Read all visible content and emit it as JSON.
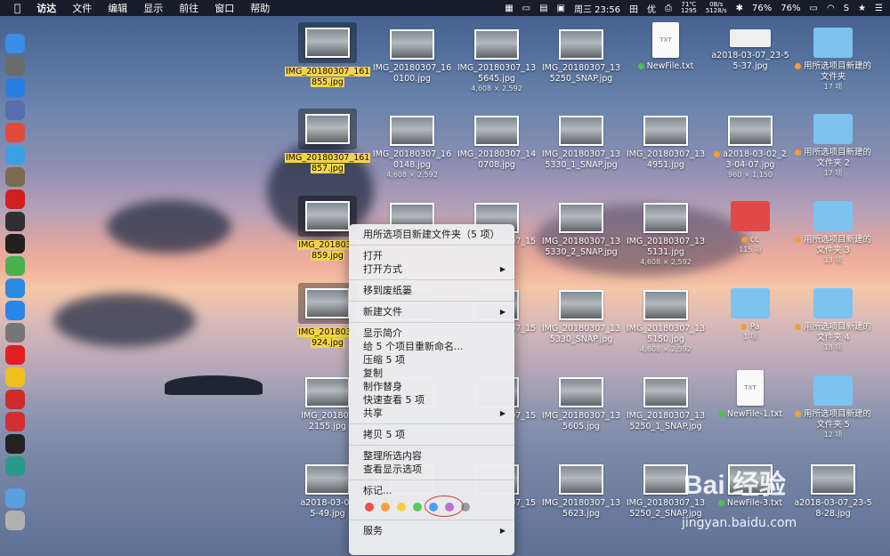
{
  "menubar": {
    "apple_icon": "apple-logo-icon",
    "items": [
      "访达",
      "文件",
      "编辑",
      "显示",
      "前往",
      "窗口",
      "帮助"
    ],
    "temp": "71℃",
    "rpm": "1295",
    "net_up": "0B/s",
    "net_down": "5128/s",
    "battery1": "76%",
    "battery2": "76%",
    "clock": "周三 23:56",
    "user": "田",
    "ime": "优"
  },
  "dock_icons": [
    "finder-icon",
    "launchpad-icon",
    "safari-icon",
    "preview-icon",
    "app-icon",
    "photos-icon",
    "app-icon",
    "stocks-icon",
    "activity-monitor-icon",
    "terminal-icon",
    "maps-icon",
    "siri-icon",
    "app-store-icon",
    "system-preferences-icon",
    "yandex-icon",
    "chrome-icon",
    "netease-music-icon",
    "vivaldi-icon",
    "terminal-icon",
    "app-icon",
    "folder-icon",
    "trash-icon"
  ],
  "files": [
    {
      "name": "IMG_20180307_161855.jpg",
      "l1": "IMG_20180307_161",
      "l2": "855.jpg",
      "type": "photo",
      "hl": true
    },
    {
      "name": "IMG_20180307_160100.jpg",
      "l1": "IMG_20180307_16",
      "l2": "0100.jpg",
      "type": "photo"
    },
    {
      "name": "IMG_20180307_135645.jpg",
      "l1": "IMG_20180307_13",
      "l2": "5645.jpg",
      "type": "photo",
      "sub": "4,608 × 2,592"
    },
    {
      "name": "IMG_20180307_135250_SNAP.jpg",
      "l1": "IMG_20180307_13",
      "l2": "5250_SNAP.jpg",
      "type": "photo"
    },
    {
      "name": "NewFile.txt",
      "l1": "NewFile.txt",
      "l2": "",
      "type": "txt",
      "tag": "#4cc24c"
    },
    {
      "name": "a2018-03-07_23-55-37.jpg",
      "l1": "a2018-03-07_23-5",
      "l2": "5-37.jpg",
      "type": "kbd"
    },
    {
      "name": "用所选项目新建的文件夹",
      "l1": "用所选项目新建的",
      "l2": "文件夹",
      "type": "folder",
      "tag": "#f0a030",
      "sub": "17 项"
    },
    {
      "name": "IMG_20180307_161857.jpg",
      "l1": "IMG_20180307_161",
      "l2": "857.jpg",
      "type": "photo",
      "hl": true
    },
    {
      "name": "IMG_20180307_160148.jpg",
      "l1": "IMG_20180307_16",
      "l2": "0148.jpg",
      "type": "photo",
      "sub": "4,608 × 2,592"
    },
    {
      "name": "IMG_20180307_140708.jpg",
      "l1": "IMG_20180307_14",
      "l2": "0708.jpg",
      "type": "photo"
    },
    {
      "name": "IMG_20180307_135330_1_SNAP.jpg",
      "l1": "IMG_20180307_13",
      "l2": "5330_1_SNAP.jpg",
      "type": "photo"
    },
    {
      "name": "IMG_20180307_134951.jpg",
      "l1": "IMG_20180307_13",
      "l2": "4951.jpg",
      "type": "photo"
    },
    {
      "name": "a2018-03-02_23-04-07.jpg",
      "l1": "a2018-03-02_2",
      "l2": "3-04-07.jpg",
      "type": "photo",
      "tag": "#f0a030",
      "sub": "960 × 1,150"
    },
    {
      "name": "用所选项目新建的文件夹 2",
      "l1": "用所选项目新建的",
      "l2": "文件夹 2",
      "type": "folder",
      "tag": "#f0a030",
      "sub": "17 项"
    },
    {
      "name": "IMG_20180307_161859.jpg",
      "l1": "IMG_2018030",
      "l2": "859.jpg",
      "type": "photo",
      "hl": true
    },
    {
      "name": "",
      "l1": "",
      "l2": "",
      "type": "photo"
    },
    {
      "name": "IMG_20180307_15",
      "l1": "IMG_20180307_15",
      "l2": "",
      "type": "photo"
    },
    {
      "name": "IMG_20180307_135330_2_SNAP.jpg",
      "l1": "IMG_20180307_13",
      "l2": "5330_2_SNAP.jpg",
      "type": "photo"
    },
    {
      "name": "IMG_20180307_135131.jpg",
      "l1": "IMG_20180307_13",
      "l2": "5131.jpg",
      "type": "photo",
      "sub": "4,608 × 2,592"
    },
    {
      "name": "cc",
      "l1": "cc",
      "l2": "",
      "type": "redfolder",
      "tag": "#f0a030",
      "sub": "115 项"
    },
    {
      "name": "用所选项目新建的文件夹 3",
      "l1": "用所选项目新建的",
      "l2": "文件夹 3",
      "type": "folder",
      "tag": "#f0a030",
      "sub": "13 项"
    },
    {
      "name": "IMG_20180307_924.jpg",
      "l1": "IMG_2018030",
      "l2": "924.jpg",
      "type": "photo",
      "hl": true
    },
    {
      "name": "",
      "l1": "",
      "l2": "",
      "type": "photo"
    },
    {
      "name": "IMG_20180307_15",
      "l1": "IMG_20180307_15",
      "l2": "",
      "type": "photo"
    },
    {
      "name": "IMG_20180307_135330_SNAP.jpg",
      "l1": "IMG_20180307_13",
      "l2": "5330_SNAP.jpg",
      "type": "photo"
    },
    {
      "name": "IMG_20180307_135150.jpg",
      "l1": "IMG_20180307_13",
      "l2": "5150.jpg",
      "type": "photo",
      "sub": "4,608 × 2,592"
    },
    {
      "name": "Pa",
      "l1": "Pa",
      "l2": "",
      "type": "folder",
      "tag": "#f0a030",
      "sub": "1 项"
    },
    {
      "name": "用所选项目新建的文件夹 4",
      "l1": "用所选项目新建的",
      "l2": "文件夹 4",
      "type": "folder",
      "tag": "#f0a030",
      "sub": "18 项"
    },
    {
      "name": "IMG_2018032155.jpg",
      "l1": "IMG_201803",
      "l2": "2155.jpg",
      "type": "photo"
    },
    {
      "name": "",
      "l1": "",
      "l2": "",
      "type": "photo"
    },
    {
      "name": "IMG_20180307_15",
      "l1": "IMG_20180307_15",
      "l2": "",
      "type": "photo"
    },
    {
      "name": "IMG_20180307_135605.jpg",
      "l1": "IMG_20180307_13",
      "l2": "5605.jpg",
      "type": "photo"
    },
    {
      "name": "IMG_20180307_135250_1_SNAP.jpg",
      "l1": "IMG_20180307_13",
      "l2": "5250_1_SNAP.jpg",
      "type": "photo"
    },
    {
      "name": "NewFile-1.txt",
      "l1": "NewFile-1.txt",
      "l2": "",
      "type": "txt",
      "tag": "#4cc24c"
    },
    {
      "name": "用所选项目新建的文件夹 5",
      "l1": "用所选项目新建的",
      "l2": "文件夹 5",
      "type": "folder",
      "tag": "#f0a030",
      "sub": "12 项"
    },
    {
      "name": "a2018-03-075-49.jpg",
      "l1": "a2018-03-07",
      "l2": "5-49.jpg",
      "type": "photo"
    },
    {
      "name": "",
      "l1": "",
      "l2": "",
      "type": "photo"
    },
    {
      "name": "IMG_20180307_15",
      "l1": "IMG_20180307_15",
      "l2": "",
      "type": "photo",
      "sub": "592"
    },
    {
      "name": "IMG_20180307_135623.jpg",
      "l1": "IMG_20180307_13",
      "l2": "5623.jpg",
      "type": "photo"
    },
    {
      "name": "IMG_20180307_135250_2_SNAP.jpg",
      "l1": "IMG_20180307_13",
      "l2": "5250_2_SNAP.jpg",
      "type": "photo"
    },
    {
      "name": "NewFile-3.txt",
      "l1": "NewFile-3.txt",
      "l2": "",
      "type": "photo",
      "tag": "#4cc24c"
    },
    {
      "name": "a2018-03-07_23-58",
      "l1": "a2018-03-07_23-5",
      "l2": "8-28.jpg",
      "type": "photo"
    }
  ],
  "context_menu": {
    "items": [
      {
        "label": "用所选项目新建文件夹（5 项）",
        "submenu": false
      },
      {
        "sep": true
      },
      {
        "label": "打开",
        "submenu": false
      },
      {
        "label": "打开方式",
        "submenu": true
      },
      {
        "sep": true
      },
      {
        "label": "移到废纸篓",
        "submenu": false
      },
      {
        "sep": true
      },
      {
        "label": "新建文件",
        "submenu": true
      },
      {
        "sep": true
      },
      {
        "label": "显示简介",
        "submenu": false
      },
      {
        "label": "给 5 个项目重新命名...",
        "submenu": false
      },
      {
        "label": "压缩 5 项",
        "submenu": false
      },
      {
        "label": "复制",
        "submenu": false
      },
      {
        "label": "制作替身",
        "submenu": false
      },
      {
        "label": "快速查看 5 项",
        "submenu": false
      },
      {
        "label": "共享",
        "submenu": true
      },
      {
        "sep": true
      },
      {
        "label": "拷贝 5 项",
        "submenu": false
      },
      {
        "sep": true
      },
      {
        "label": "整理所选内容",
        "submenu": false
      },
      {
        "label": "查看显示选项",
        "submenu": false
      },
      {
        "sep": true
      },
      {
        "label": "标记...",
        "submenu": false
      }
    ],
    "tag_colors": [
      "#f0504a",
      "#f5a03a",
      "#f5d03a",
      "#5ac85a",
      "#4aa0f0",
      "#c070d0",
      "#9a9a9a"
    ],
    "services_label": "服务"
  },
  "watermark": {
    "brand": "Bai 经验",
    "url": "jingyan.baidu.com"
  }
}
